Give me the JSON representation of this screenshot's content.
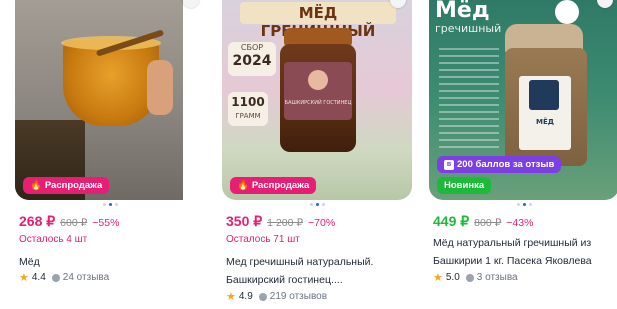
{
  "colors": {
    "pink": "#e61e74",
    "green": "#1dba3a",
    "purple": "#7b3fe4"
  },
  "products": [
    {
      "price": "268 ₽",
      "old_price": "600 ₽",
      "discount": "−55%",
      "stock": "Осталось 4 шт",
      "title": "Мёд",
      "rating": "4.4",
      "reviews": "24 отзыва",
      "badge": "Распродажа"
    },
    {
      "price": "350 ₽",
      "old_price": "1 200 ₽",
      "discount": "−70%",
      "stock": "Осталось 71 шт",
      "title": "Мед гречишный натуральный. Башкирский гостинец....",
      "rating": "4.9",
      "reviews": "219 отзывов",
      "badge": "Распродажа",
      "image_text": {
        "title": "МЁД ГРЕЧИШНЫЙ",
        "year_label": "СБОР",
        "year": "2024",
        "weight": "1100",
        "weight_unit": "ГРАММ",
        "jar_label": "БАШКИРСКИЙ ГОСТИНЕЦ"
      }
    },
    {
      "price": "449 ₽",
      "old_price": "800 ₽",
      "discount": "−43%",
      "title": "Мёд натуральный гречишный из Башкирии 1 кг. Пасека Яковлева",
      "rating": "5.0",
      "reviews": "3 отзыва",
      "badge": "Новинка",
      "points_badge": "200 баллов за отзыв",
      "image_text": {
        "title_big": "Мёд",
        "title_small": "гречишный",
        "jar_label": "МЁД"
      }
    }
  ]
}
